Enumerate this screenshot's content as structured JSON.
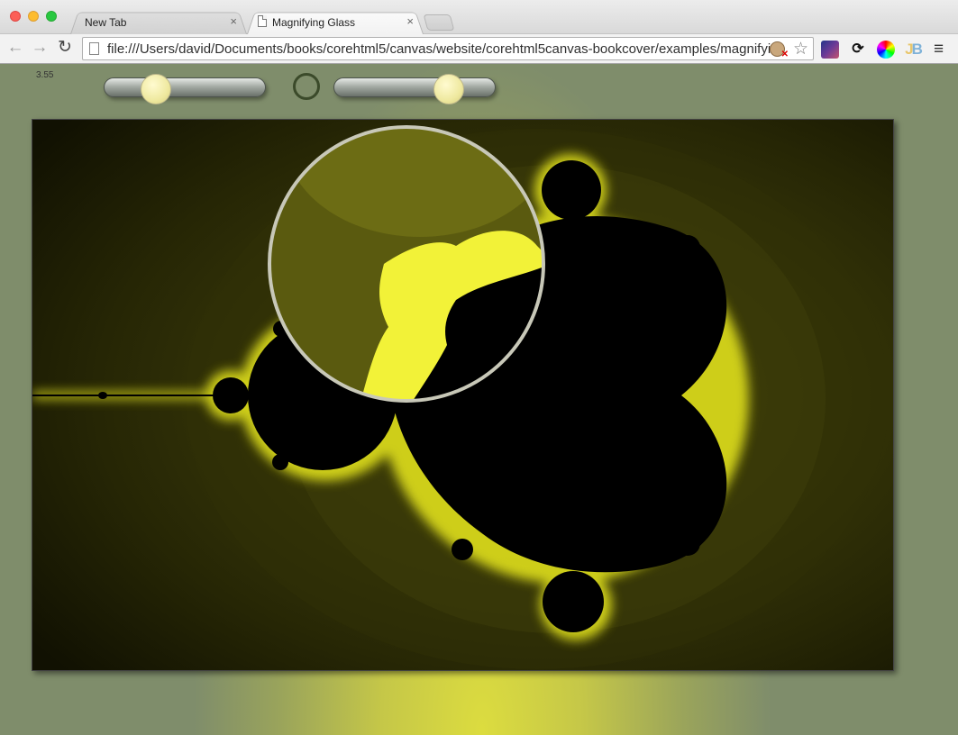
{
  "browser": {
    "tabs": [
      {
        "label": "New Tab",
        "active": false
      },
      {
        "label": "Magnifying Glass",
        "active": true
      }
    ],
    "url": "file:///Users/david/Documents/books/corehtml5/canvas/website/corehtml5canvas-bookcover/examples/magnifyi...",
    "close_glyph": "×",
    "icons": [
      "back-arrow-icon",
      "forward-arrow-icon",
      "reload-icon",
      "page-icon",
      "extension-icon",
      "bookmark-star-icon",
      "menu-icon"
    ]
  },
  "app": {
    "readout": "3.55",
    "controls": {
      "left_slider": {
        "value_fraction": 0.33
      },
      "right_slider": {
        "value_fraction": 0.7
      },
      "ring_toggle": "magnifier-toggle"
    },
    "colors": {
      "fractal_glow": "#ffff00",
      "fractal_set": "#000000",
      "background_dark": "#161603",
      "page_gradient_center": "#dcdc3f",
      "page_gradient_edge": "#7f8d6b"
    }
  }
}
